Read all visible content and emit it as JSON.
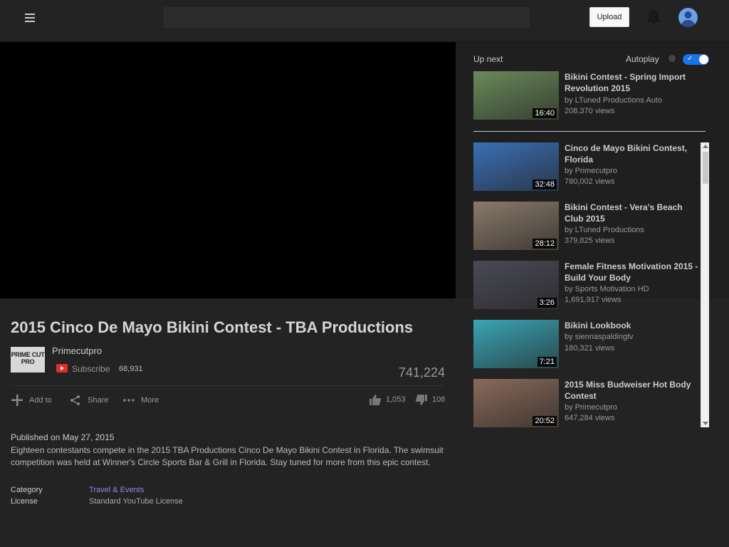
{
  "header": {
    "search_placeholder": "",
    "upload_label": "Upload",
    "icons": {
      "menu": "hamburger-icon",
      "bell": "bell-icon",
      "avatar": "avatar"
    }
  },
  "video": {
    "title": "2015 Cinco De Mayo Bikini Contest - TBA Productions",
    "channel": "Primecutpro",
    "channel_logo_text": "PRIME CUT PRO",
    "subscribe_label": "Subscribe",
    "subscriber_count": "68,931",
    "views": "741,224",
    "actions": {
      "add_to": "Add to",
      "share": "Share",
      "more": "More"
    },
    "likes": "1,053",
    "dislikes": "108",
    "published": "Published on May 27, 2015",
    "description": "Eighteen contestants compete in the 2015 TBA Productions Cinco De Mayo Bikini Contest in Florida. The swimsuit competition was held at Winner's Circle Sports Bar & Grill in Florida. Stay tuned for more from this epic contest.",
    "category_label": "Category",
    "category_value": "Travel & Events",
    "license_label": "License",
    "license_value": "Standard YouTube License"
  },
  "sidebar": {
    "up_next_label": "Up next",
    "autoplay_label": "Autoplay",
    "autoplay_on": true,
    "items": [
      {
        "title": "Bikini Contest - Spring Import Revolution 2015",
        "author": "by LTuned Productions Auto",
        "views": "208,370 views",
        "duration": "16:40",
        "thumb_color": "#6a8a5a"
      },
      {
        "title": "Cinco de Mayo Bikini Contest, Florida",
        "author": "by Primecutpro",
        "views": "780,002 views",
        "duration": "32:48",
        "thumb_color": "#3a6fb5"
      },
      {
        "title": "Bikini Contest - Vera's Beach Club 2015",
        "author": "by LTuned Productions",
        "views": "379,825 views",
        "duration": "28:12",
        "thumb_color": "#8a7a6a"
      },
      {
        "title": "Female Fitness Motivation 2015 - Build Your Body",
        "author": "by Sports Motivation HD",
        "views": "1,691,917 views",
        "duration": "3:26",
        "thumb_color": "#4a4a55"
      },
      {
        "title": "Bikini Lookbook",
        "author": "by siennaspaldingtv",
        "views": "180,321 views",
        "duration": "7:21",
        "thumb_color": "#3aa5b5"
      },
      {
        "title": "2015 Miss Budweiser Hot Body Contest",
        "author": "by Primecutpro",
        "views": "647,284 views",
        "duration": "20:52",
        "thumb_color": "#8a6a5a"
      }
    ]
  }
}
